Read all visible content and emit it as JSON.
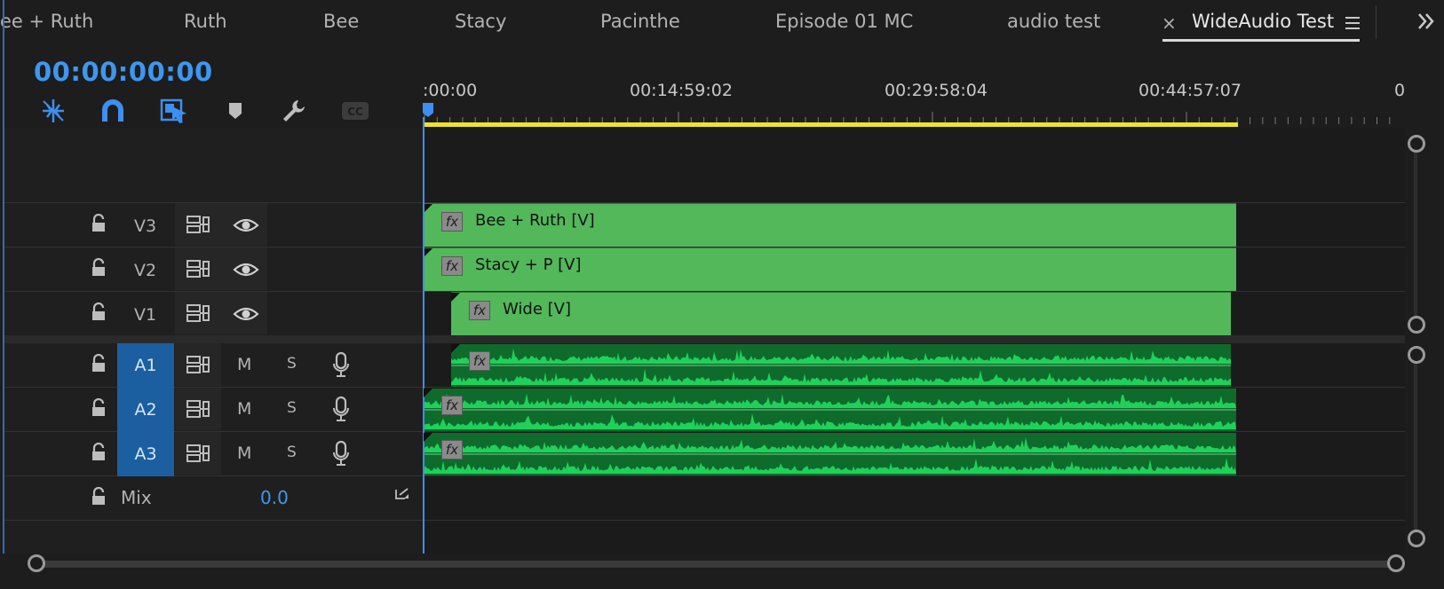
{
  "tabs": [
    {
      "label": "ee + Ruth"
    },
    {
      "label": "Ruth"
    },
    {
      "label": "Bee"
    },
    {
      "label": "Stacy"
    },
    {
      "label": "Pacinthe"
    },
    {
      "label": "Episode 01 MC"
    },
    {
      "label": "audio test"
    },
    {
      "label": "WideAudio Test",
      "active": true
    }
  ],
  "tab_close_symbol": "×",
  "panel_menu_icon": "hamburger-menu-icon",
  "overflow_icon": "double-chevron-right-icon",
  "timecode": "00:00:00:00",
  "tools": [
    {
      "icon": "nest-sequence-icon"
    },
    {
      "icon": "snap-magnet-icon"
    },
    {
      "icon": "linked-selection-icon"
    },
    {
      "icon": "add-marker-icon"
    },
    {
      "icon": "timeline-settings-wrench-icon"
    },
    {
      "icon": "captions-cc-icon",
      "label": "CC"
    }
  ],
  "ruler": {
    "labels": [
      ":00:00",
      "00:14:59:02",
      "00:29:58:04",
      "00:44:57:07",
      "0"
    ]
  },
  "video_tracks": [
    {
      "name": "V3",
      "clip": "Bee + Ruth [V]"
    },
    {
      "name": "V2",
      "clip": "Stacy + P [V]"
    },
    {
      "name": "V1",
      "clip": "Wide [V]"
    }
  ],
  "audio_tracks": [
    {
      "name": "A1",
      "mute": "M",
      "solo": "S"
    },
    {
      "name": "A2",
      "mute": "M",
      "solo": "S"
    },
    {
      "name": "A3",
      "mute": "M",
      "solo": "S"
    }
  ],
  "mix": {
    "label": "Mix",
    "value": "0.0"
  },
  "fx_label": "fx",
  "colors": {
    "video_clip": "#52b85a",
    "audio_clip": "#0e6b2c",
    "waveform": "#1fd15a",
    "timecode": "#3d97f0",
    "in_out_bar": "#f0e427",
    "track_target": "#1b5fa0"
  }
}
